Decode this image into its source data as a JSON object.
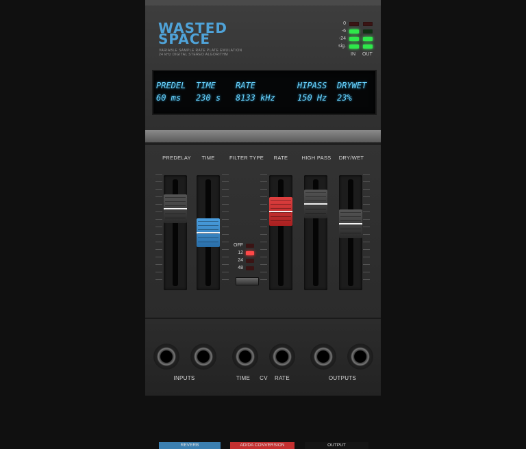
{
  "plugin": {
    "title_line1": "WASTED",
    "title_line2": "SPACE",
    "subtitle_line1": "VARIABLE SAMPLE RATE PLATE EMULATION",
    "subtitle_line2": "24 kHz DIGITAL STEREO ALGORITHM",
    "accent_color": "#4fa3d9"
  },
  "meters": {
    "rows": [
      {
        "label": "0",
        "in": "off",
        "out": "off"
      },
      {
        "label": "-6",
        "in": "on",
        "out": "off"
      },
      {
        "label": "-24",
        "in": "on",
        "out": "on"
      },
      {
        "label": "sig.",
        "in": "on",
        "out": "on"
      }
    ],
    "in_label": "IN",
    "out_label": "OUT"
  },
  "display": {
    "headers": [
      "PREDEL",
      "TIME",
      "RATE",
      "HIPASS",
      "DRYWET"
    ],
    "predelay_value": "60 ms",
    "time_value": "230 s",
    "rate_value": "8133 kHz",
    "hipass_value": "150 Hz",
    "drywet_value": "23%"
  },
  "controls": {
    "predelay_label": "PREDELAY",
    "time_label": "TIME",
    "filter_type_label": "FILTER TYPE",
    "rate_label": "RATE",
    "high_pass_label": "HIGH PASS",
    "dry_wet_label": "DRY/WET",
    "slider_levels": {
      "predelay": 0.78,
      "time": 0.5,
      "rate": 0.75,
      "high_pass": 0.83,
      "dry_wet": 0.6
    },
    "filter_options": [
      {
        "label": "OFF",
        "active": false
      },
      {
        "label": "12",
        "active": true
      },
      {
        "label": "24",
        "active": false
      },
      {
        "label": "48",
        "active": false
      }
    ]
  },
  "sections": {
    "reverb": {
      "label": "REVERB",
      "color": "#3b7fb0"
    },
    "adda": {
      "label": "AD/DA CONVERSION",
      "color": "#c43030"
    },
    "output": {
      "label": "OUTPUT",
      "color": "#1a1a1a"
    }
  },
  "jacks": {
    "inputs_label": "INPUTS",
    "time_label": "TIME",
    "cv_label": "CV",
    "rate_label": "RATE",
    "outputs_label": "OUTPUTS"
  }
}
